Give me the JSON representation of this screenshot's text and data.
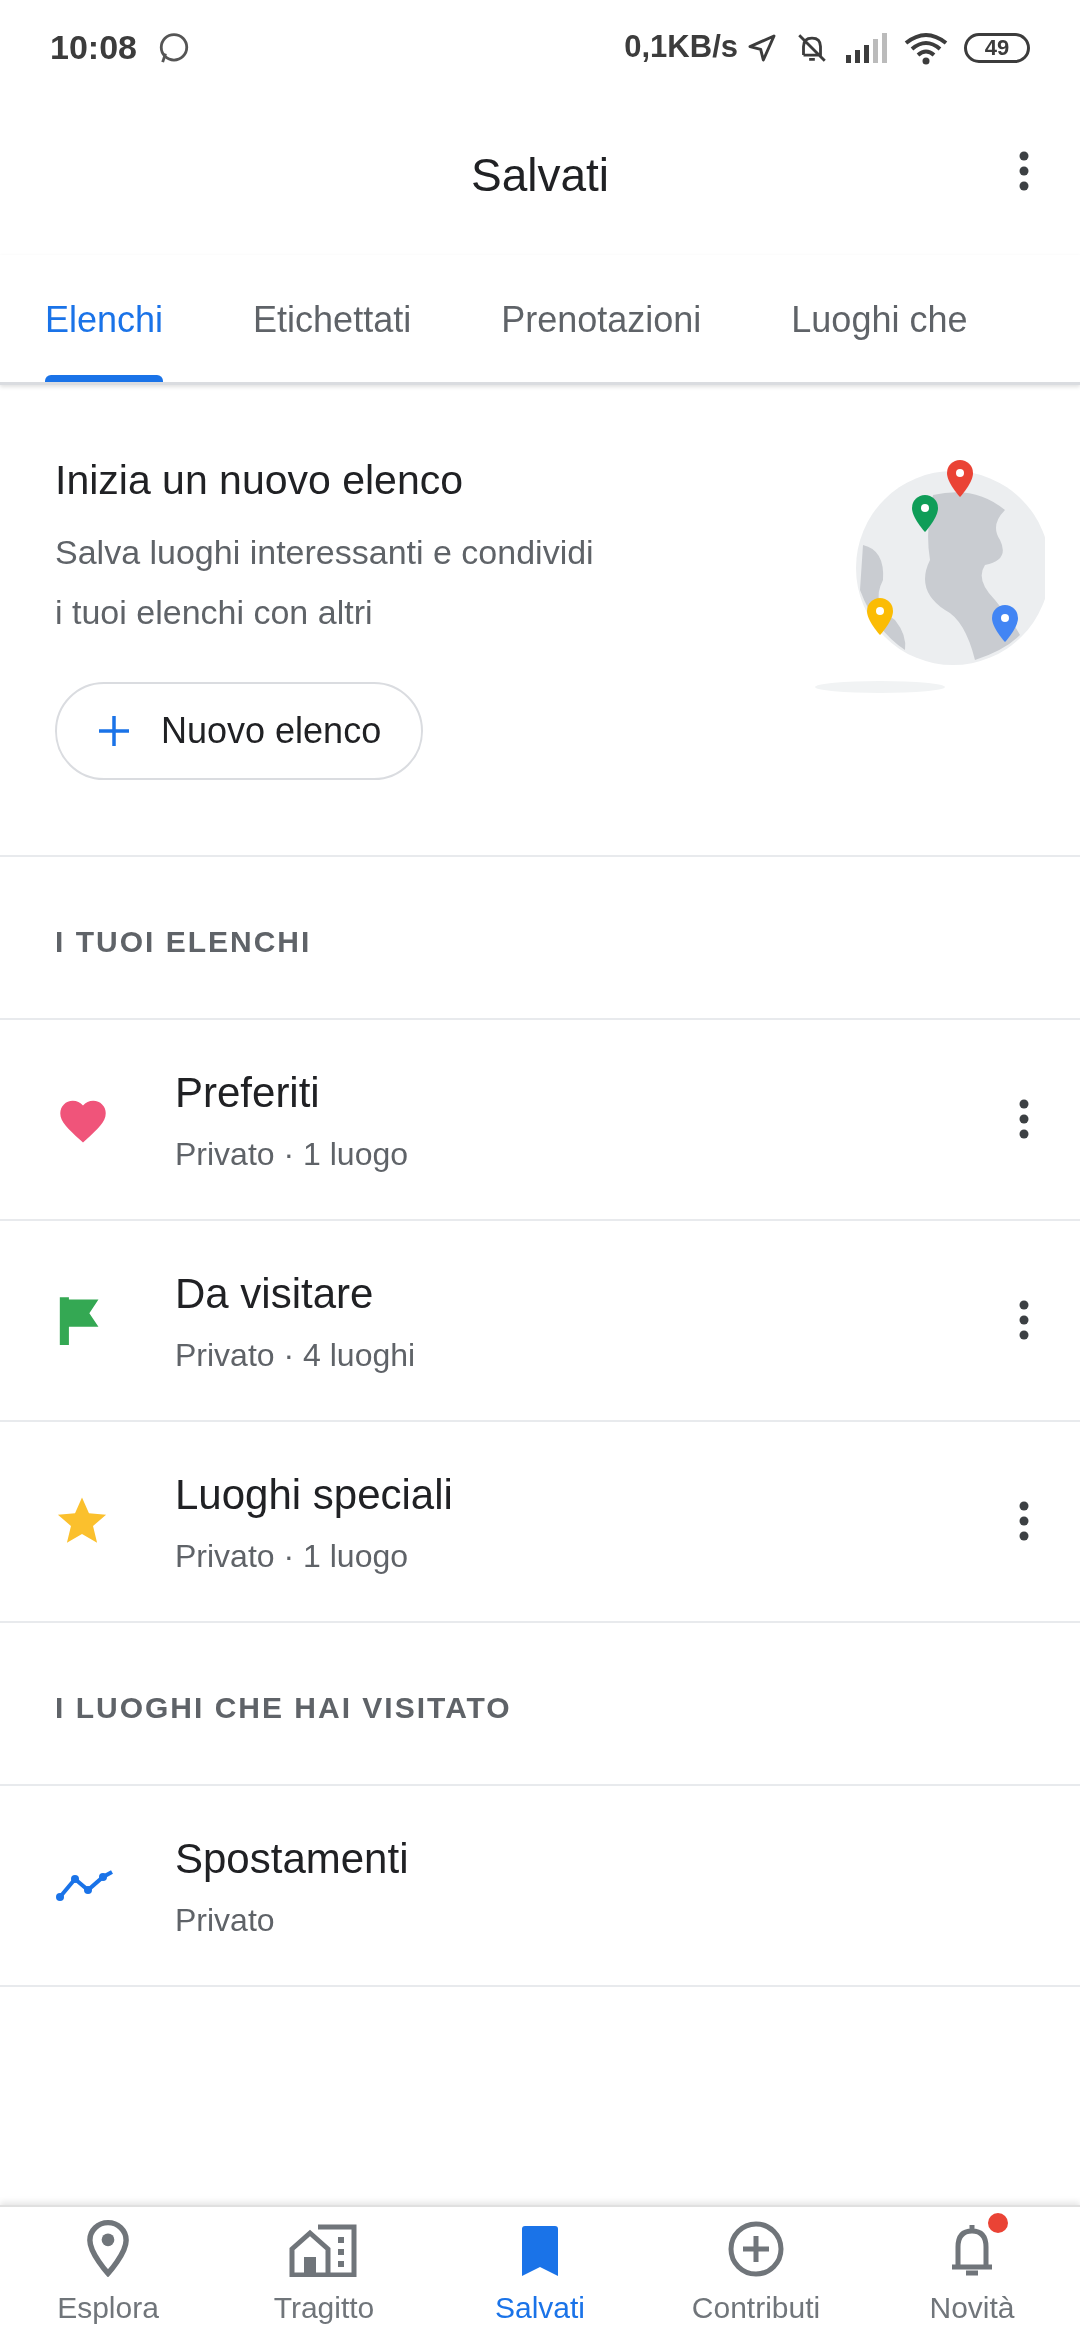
{
  "status_bar": {
    "time": "10:08",
    "speed": "0,1KB/s",
    "battery": "49"
  },
  "header": {
    "title": "Salvati"
  },
  "tabs": [
    {
      "label": "Elenchi",
      "selected": true
    },
    {
      "label": "Etichettati",
      "selected": false
    },
    {
      "label": "Prenotazioni",
      "selected": false
    },
    {
      "label": "Luoghi che",
      "selected": false
    }
  ],
  "promo": {
    "title": "Inizia un nuovo elenco",
    "text": "Salva luoghi interessanti e condividi i tuoi elenchi con altri",
    "button": "Nuovo elenco"
  },
  "sections": [
    {
      "heading": "I TUOI ELENCHI",
      "items": [
        {
          "kind": "heart",
          "title": "Preferiti",
          "subtitle": "Privato · 1 luogo",
          "menu": true
        },
        {
          "kind": "flag",
          "title": "Da visitare",
          "subtitle": "Privato · 4 luoghi",
          "menu": true
        },
        {
          "kind": "star",
          "title": "Luoghi speciali",
          "subtitle": "Privato · 1 luogo",
          "menu": true
        }
      ]
    },
    {
      "heading": "I LUOGHI CHE HAI VISITATO",
      "items": [
        {
          "kind": "timeline",
          "title": "Spostamenti",
          "subtitle": "Privato",
          "menu": false
        }
      ]
    }
  ],
  "bottom_nav": [
    {
      "kind": "pin",
      "label": "Esplora",
      "selected": false,
      "badge": false
    },
    {
      "kind": "commute",
      "label": "Tragitto",
      "selected": false,
      "badge": false
    },
    {
      "kind": "bookmark",
      "label": "Salvati",
      "selected": true,
      "badge": false
    },
    {
      "kind": "add",
      "label": "Contributi",
      "selected": false,
      "badge": false
    },
    {
      "kind": "bell",
      "label": "Novità",
      "selected": false,
      "badge": true
    }
  ]
}
